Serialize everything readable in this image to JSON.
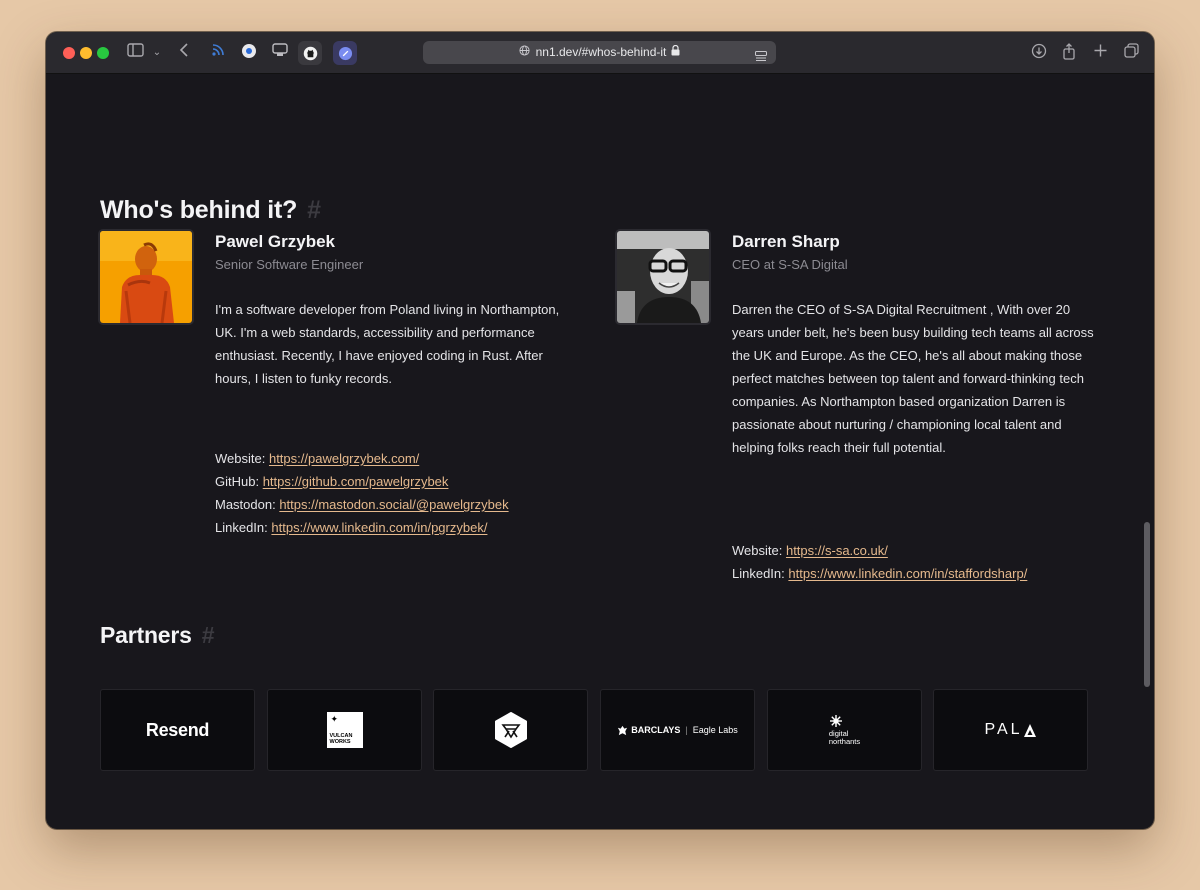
{
  "browser": {
    "url": "nn1.dev/#whos-behind-it"
  },
  "team_section": {
    "title": "Who's behind it?",
    "anchor": "#"
  },
  "people": [
    {
      "name": "Pawel Grzybek",
      "role": "Senior Software Engineer",
      "bio": "I'm a software developer from Poland living in Northampton, UK. I'm a web standards, accessibility and performance enthusiast. Recently, I have enjoyed coding in Rust. After hours, I listen to funky records.",
      "links": [
        {
          "label": "Website:",
          "url": "https://pawelgrzybek.com/"
        },
        {
          "label": "GitHub:",
          "url": "https://github.com/pawelgrzybek"
        },
        {
          "label": "Mastodon:",
          "url": "https://mastodon.social/@pawelgrzybek"
        },
        {
          "label": "LinkedIn:",
          "url": "https://www.linkedin.com/in/pgrzybek/"
        }
      ]
    },
    {
      "name": "Darren Sharp",
      "role": "CEO at S-SA Digital",
      "bio": "Darren the CEO of S-SA Digital Recruitment , With over 20 years under belt, he's been busy building tech teams all across the UK and Europe. As the CEO, he's all about making those perfect matches between top talent and forward-thinking tech companies. As Northampton based organization Darren is passionate about nurturing / championing local talent and helping folks reach their full potential.",
      "links": [
        {
          "label": "Website:",
          "url": "https://s-sa.co.uk/"
        },
        {
          "label": "LinkedIn:",
          "url": "https://www.linkedin.com/in/staffordsharp/"
        }
      ]
    }
  ],
  "partners_section": {
    "title": "Partners",
    "anchor": "#",
    "logos": {
      "resend": "Resend",
      "vulcan_line1": "VULCAN",
      "vulcan_line2": "WORKS",
      "barclays": "BARCLAYS",
      "eagle_labs": "Eagle Labs",
      "digital_line1": "digital",
      "digital_line2": "northants",
      "pala": "PAL"
    }
  },
  "colors": {
    "background": "#18171c",
    "link": "#e5b98d",
    "heading": "#f4f4f6",
    "muted": "#8c8b92",
    "avatar_accent": "#f6a000"
  },
  "icons": [
    "sidebar-icon",
    "chevron-down-icon",
    "back-icon",
    "rss-icon",
    "extension-icon",
    "github-icon",
    "globe-icon",
    "lock-icon",
    "reader-icon",
    "download-icon",
    "share-icon",
    "plus-icon",
    "tabs-icon"
  ]
}
